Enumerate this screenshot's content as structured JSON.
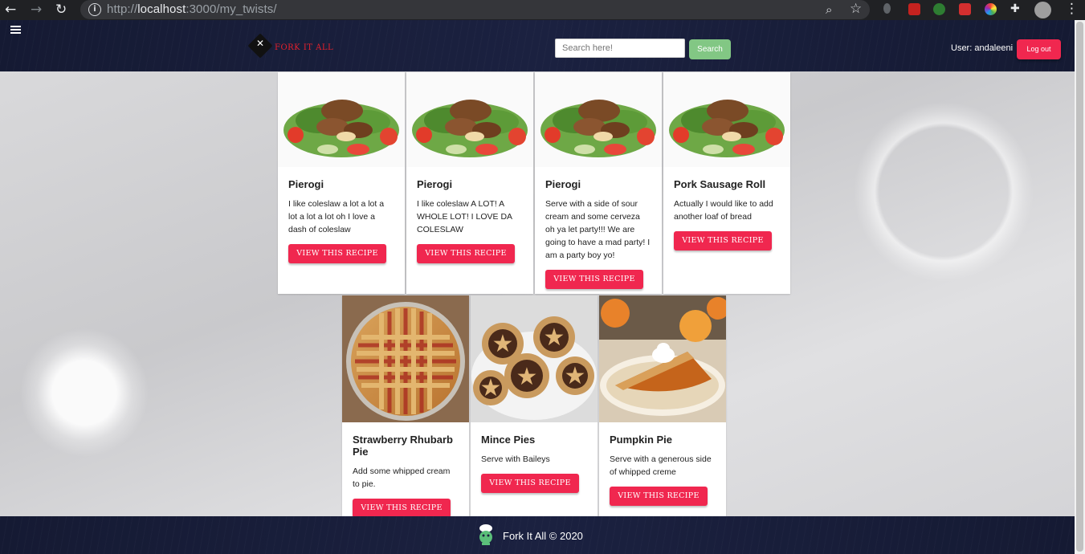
{
  "browser": {
    "url_scheme": "http://",
    "url_host": "localhost",
    "url_path": ":3000/my_twists/"
  },
  "header": {
    "logo_text": "FORK IT ALL",
    "search_placeholder": "Search here!",
    "search_button": "Search",
    "user_label": "User: andaleeni",
    "logout_button": "Log out"
  },
  "recipes": [
    {
      "title": "Pierogi",
      "description": "I like coleslaw a lot a lot a lot a lot a lot oh I love a dash of coleslaw",
      "button": "VIEW THIS RECIPE",
      "image": "beef-salad-image"
    },
    {
      "title": "Pierogi",
      "description": "I like coleslaw A LOT! A WHOLE LOT! I LOVE DA COLESLAW",
      "button": "VIEW THIS RECIPE",
      "image": "beef-salad-image"
    },
    {
      "title": "Pierogi",
      "description": "Serve with a side of sour cream and some cerveza oh ya let party!!! We are going to have a mad party! I am a party boy yo!",
      "button": "VIEW THIS RECIPE",
      "image": "beef-salad-image"
    },
    {
      "title": "Pork Sausage Roll",
      "description": "Actually I would like to add another loaf of bread",
      "button": "VIEW THIS RECIPE",
      "image": "beef-salad-image"
    },
    {
      "title": "Strawberry Rhubarb Pie",
      "description": "Add some whipped cream to pie.",
      "button": "VIEW THIS RECIPE",
      "image": "lattice-pie-image"
    },
    {
      "title": "Mince Pies",
      "description": "Serve with Baileys",
      "button": "VIEW THIS RECIPE",
      "image": "mince-pies-image"
    },
    {
      "title": "Pumpkin Pie",
      "description": "Serve with a generous side of whipped creme",
      "button": "VIEW THIS RECIPE",
      "image": "pumpkin-pie-image"
    }
  ],
  "footer": {
    "text": "Fork It All © 2020"
  },
  "colors": {
    "accent": "#f0274f",
    "search_button": "#82c784",
    "header_bg": "#1b2140"
  }
}
